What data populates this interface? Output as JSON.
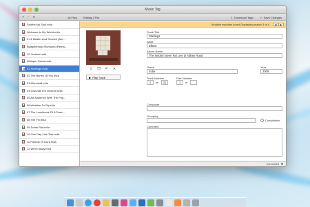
{
  "window": {
    "title": "Music Tag"
  },
  "toolbar": {
    "file_count": "18 Files",
    "editing": "Editing 1 File",
    "download_tags": "Download Tags",
    "save_changes": "Save Changes"
  },
  "banner": {
    "message": "Multiple matches found Displaying match 3 of 4"
  },
  "tracks": [
    {
      "name": "Soothe My Soul.m4a",
      "selected": false
    },
    {
      "name": "Welcome to My World.m4a",
      "selected": false
    },
    {
      "name": "2-11 Master And Servant (Am...",
      "selected": false
    },
    {
      "name": "Blasphemous Rumours (Rema...",
      "selected": false
    },
    {
      "name": "12 Jezebel.m4a",
      "selected": false
    },
    {
      "name": "Whisper Grass.m4a",
      "selected": false
    },
    {
      "name": "01 Starlings.m4a",
      "selected": true
    },
    {
      "name": "02 The Bones Of You.m4a",
      "selected": false
    },
    {
      "name": "03 Mirrorball.m4a",
      "selected": false
    },
    {
      "name": "04 Grounds For Divorce.m4a",
      "selected": false
    },
    {
      "name": "05 An Audience With The Pop...",
      "selected": false
    },
    {
      "name": "06 Weather To Fly.m4a",
      "selected": false
    },
    {
      "name": "07 The Loneliness Of A Towe...",
      "selected": false
    },
    {
      "name": "08 The Fix.m4a",
      "selected": false
    },
    {
      "name": "09 Some Riot.m4a",
      "selected": false
    },
    {
      "name": "10 One Day Like This.m4a",
      "selected": false
    },
    {
      "name": "11 Friends Of Ours.m4a",
      "selected": false
    },
    {
      "name": "12 We're Away.m4a",
      "selected": false
    }
  ],
  "play_track": "Play Track",
  "fields": {
    "track_title_label": "Track Title",
    "track_title": "Starlings",
    "artist_label": "Artist",
    "artist": "Elbow",
    "album_label": "Album Name",
    "album": "The Seldom Seen Kid Live at Abbey Road",
    "genre_label": "Genre",
    "genre": "Indie",
    "year_label": "Year",
    "year": "2009",
    "track_number_label": "Track Number",
    "track_number": "1",
    "track_of": "of",
    "track_total": "11",
    "disc_number_label": "Disc Number",
    "disc_number": "1",
    "disc_of": "of",
    "disc_total": "",
    "composer_label": "Composer",
    "composer": "",
    "grouping_label": "Grouping",
    "grouping": "",
    "compilation_label": "Compilation",
    "comment_label": "Comment",
    "comment": ""
  },
  "status": {
    "text": "Connected"
  },
  "icons": {
    "add": "+",
    "remove": "−",
    "list": "≡",
    "download": "⇩",
    "save": "✓",
    "prev": "◀",
    "next": "▶"
  }
}
